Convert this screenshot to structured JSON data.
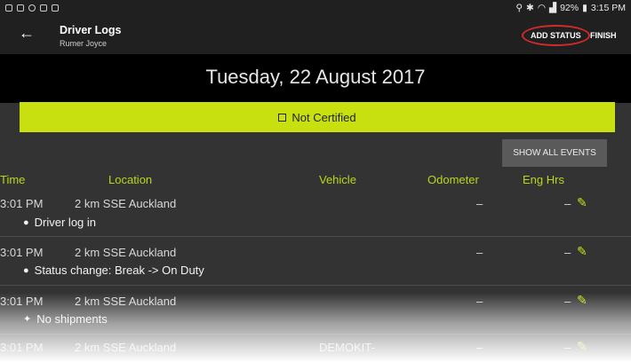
{
  "statusbar": {
    "battery": "92%",
    "time": "3:15 PM"
  },
  "appbar": {
    "title": "Driver Logs",
    "subtitle": "Rumer Joyce",
    "add_status": "ADD STATUS",
    "finish": "FINISH"
  },
  "date": "Tuesday, 22 August 2017",
  "certification": {
    "label": "Not Certified"
  },
  "show_all_events": "SHOW ALL EVENTS",
  "columns": {
    "time": "Time",
    "location": "Location",
    "vehicle": "Vehicle",
    "odometer": "Odometer",
    "eng_hrs": "Eng Hrs"
  },
  "rows": [
    {
      "time": "3:01 PM",
      "location": "2 km SSE Auckland",
      "vehicle": "",
      "odometer": "–",
      "eng_hrs": "–",
      "desc": "Driver log in",
      "icon": "person-icon"
    },
    {
      "time": "3:01 PM",
      "location": "2 km SSE Auckland",
      "vehicle": "",
      "odometer": "–",
      "eng_hrs": "–",
      "desc": "Status change: Break -> On Duty",
      "icon": "person-icon"
    },
    {
      "time": "3:01 PM",
      "location": "2 km SSE Auckland",
      "vehicle": "",
      "odometer": "–",
      "eng_hrs": "–",
      "desc": "No shipments",
      "icon": "sparkle-icon"
    },
    {
      "time": "3:01 PM",
      "location": "2 km SSE Auckland",
      "vehicle": "DEMOKIT-",
      "odometer": "–",
      "eng_hrs": "–",
      "desc": "",
      "icon": ""
    }
  ]
}
